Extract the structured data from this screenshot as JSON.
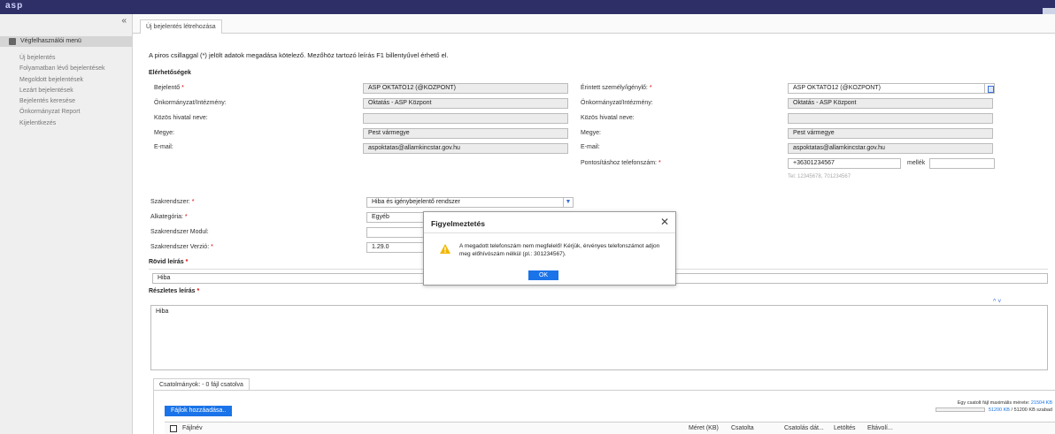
{
  "header": {
    "logo": "asp"
  },
  "sidebar": {
    "collapse_glyph": "«",
    "menu_title": "Végfelhasználói menü",
    "items": [
      {
        "label": "Új bejelentés"
      },
      {
        "label": "Folyamatban lévő bejelentések"
      },
      {
        "label": "Megoldott bejelentések"
      },
      {
        "label": "Lezárt bejelentések"
      },
      {
        "label": "Bejelentés keresése"
      },
      {
        "label": "Önkormányzat Report"
      },
      {
        "label": "Kijelentkezés"
      }
    ]
  },
  "tab": {
    "label": "Új bejelentés létrehozása"
  },
  "form": {
    "note": "A piros csillaggal (*) jelölt adatok megadása kötelező. Mezőhöz tartozó leírás F1 billentyűvel érhető el.",
    "contacts_title": "Elérhetőségek",
    "left": {
      "reporter_label": "Bejelentő",
      "reporter_value": "ASP OKTATÓ12 (@KOZPONT)",
      "org_label": "Önkormányzat/Intézmény:",
      "org_value": "Oktatás - ASP Központ",
      "office_label": "Közös hivatal neve:",
      "office_value": "",
      "county_label": "Megye:",
      "county_value": "Pest vármegye",
      "email_label": "E-mail:",
      "email_value": "aspoktatas@allamkincstar.gov.hu"
    },
    "right": {
      "person_label": "Érintett személy/igénylő:",
      "person_value": "ASP OKTATÓ12 (@KOZPONT)",
      "org_label": "Önkormányzat/Intézmény:",
      "org_value": "Oktatás - ASP Központ",
      "office_label": "Közös hivatal neve:",
      "office_value": "",
      "county_label": "Megye:",
      "county_value": "Pest vármegye",
      "email_label": "E-mail:",
      "email_value": "aspoktatas@allamkincstar.gov.hu",
      "phone_label": "Pontosításhoz telefonszám:",
      "phone_value": "+36301234567",
      "ext_label": "mellék",
      "ext_value": "",
      "phone_hint": "Tel: 12345678, 701234567"
    },
    "system": {
      "system_label": "Szakrendszer:",
      "system_value": "Hiba és igénybejelentő rendszer",
      "subcat_label": "Alkategória:",
      "subcat_value": "Egyéb",
      "module_label": "Szakrendszer Modul:",
      "module_value": "",
      "version_label": "Szakrendszer Verzió:",
      "version_value": "1.29.0"
    },
    "short_desc_label": "Rövid leírás",
    "short_desc_value": "Hiba",
    "detail_desc_label": "Részletes leírás",
    "detail_desc_value": "Hiba",
    "editor_ctrl": "^ ˅",
    "req_mark": "*"
  },
  "attachments": {
    "tab_label": "Csatolmányok: - 0 fájl csatolva",
    "add_button": "Fájlok hozzáadása..",
    "limit_line1_prefix": "Egy csatolt fájl maximális mérete:",
    "limit_line1_value": "21504 KB",
    "limit_line2_used": "51200 KB",
    "limit_line2_rest": "/ 51200 KB szabad",
    "columns": {
      "name": "Fájlnév",
      "size": "Méret (KB)",
      "attached": "Csatolta",
      "attach_date": "Csatolás dát...",
      "download": "Letöltés",
      "remove": "Eltávolí..."
    }
  },
  "dialog": {
    "title": "Figyelmeztetés",
    "close_glyph": "✕",
    "message": "A megadott telefonszám nem megfelelő! Kérjük, érvényes telefonszámot adjon meg előhívószám nélkül (pl.: 301234567).",
    "ok_label": "OK"
  },
  "colors": {
    "topbar": "#2d2f66",
    "accent": "#1a73e8",
    "required": "#dd0000",
    "warning": "#f2b705"
  }
}
